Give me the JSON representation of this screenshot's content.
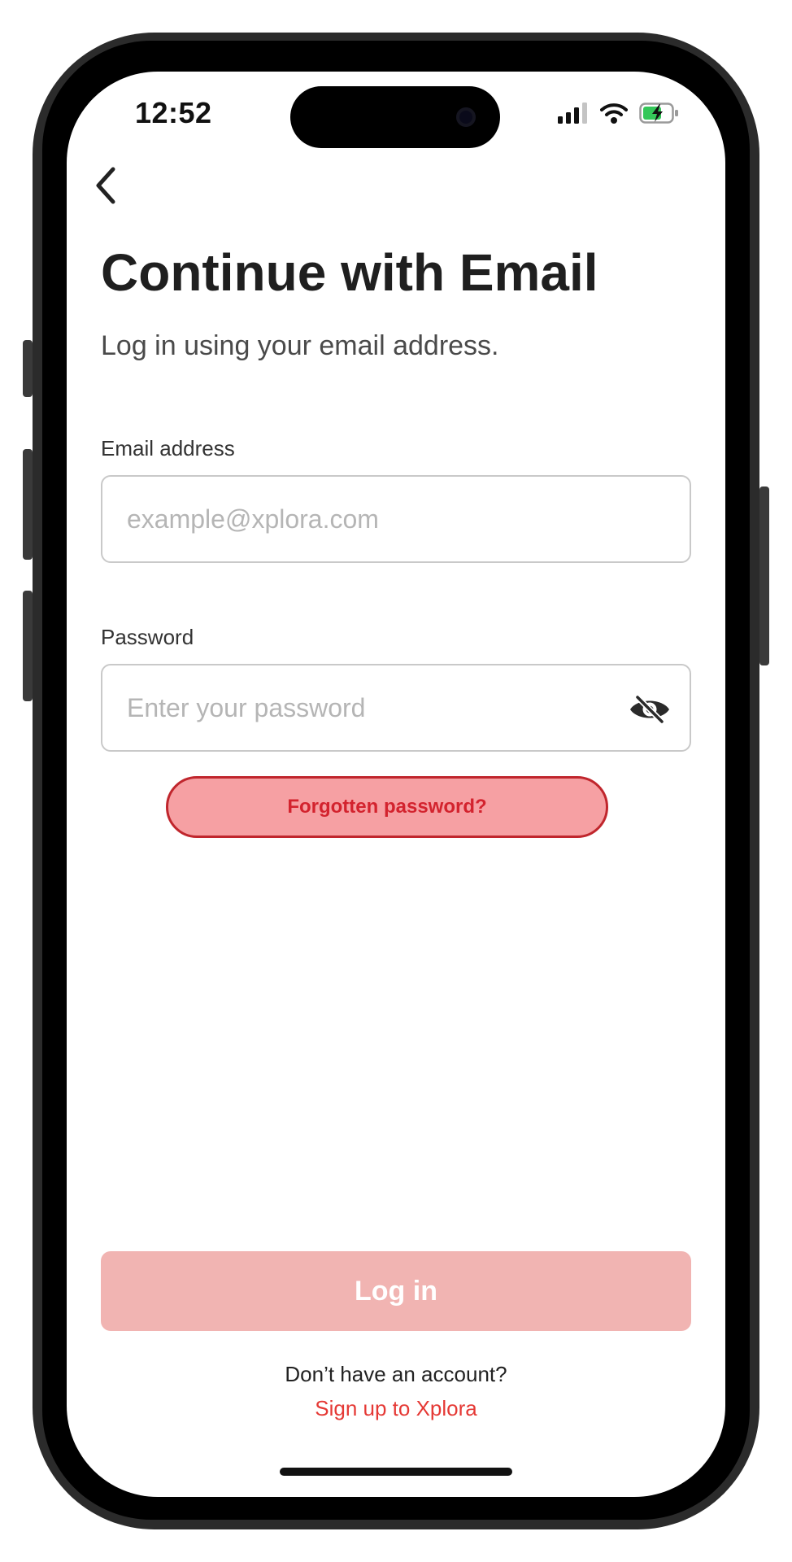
{
  "status_bar": {
    "time": "12:52"
  },
  "header": {
    "title": "Continue with Email",
    "subtitle": "Log in using your email address."
  },
  "form": {
    "email": {
      "label": "Email address",
      "placeholder": "example@xplora.com",
      "value": ""
    },
    "password": {
      "label": "Password",
      "placeholder": "Enter your password",
      "value": "",
      "toggle_icon": "eye-hidden-icon"
    },
    "forgot_label": "Forgotten password?"
  },
  "actions": {
    "login_label": "Log in"
  },
  "footer": {
    "prompt": "Don’t have an account?",
    "signup_label": "Sign up to Xplora"
  },
  "colors": {
    "accent": "#e53935",
    "login_disabled_bg": "#f1b4b2",
    "forgot_bg": "#f6a0a3",
    "forgot_border": "#c0262d"
  }
}
